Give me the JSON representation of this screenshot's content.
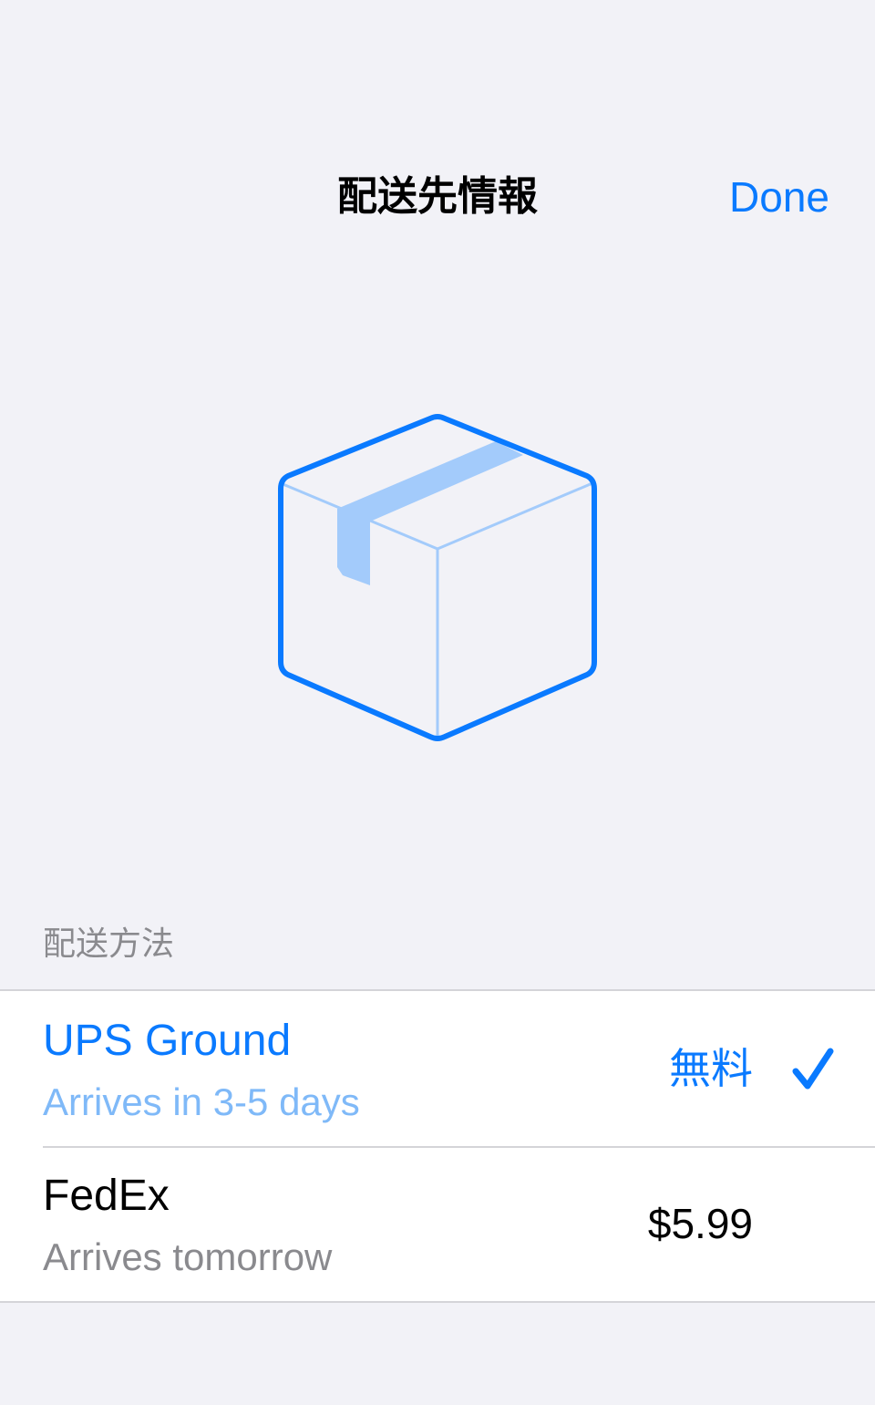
{
  "nav": {
    "title": "配送先情報",
    "done_label": "Done"
  },
  "hero": {
    "icon": "shipping-box-icon"
  },
  "shipping": {
    "section_header": "配送方法",
    "methods": [
      {
        "name": "UPS Ground",
        "detail": "Arrives in 3-5 days",
        "price": "無料",
        "selected": true
      },
      {
        "name": "FedEx",
        "detail": "Arrives tomorrow",
        "price": "$5.99",
        "selected": false
      }
    ]
  },
  "colors": {
    "accent": "#0a7aff",
    "accent_light": "#a3cbfb",
    "background": "#f2f2f7",
    "secondary_text": "#8a8a8e"
  }
}
